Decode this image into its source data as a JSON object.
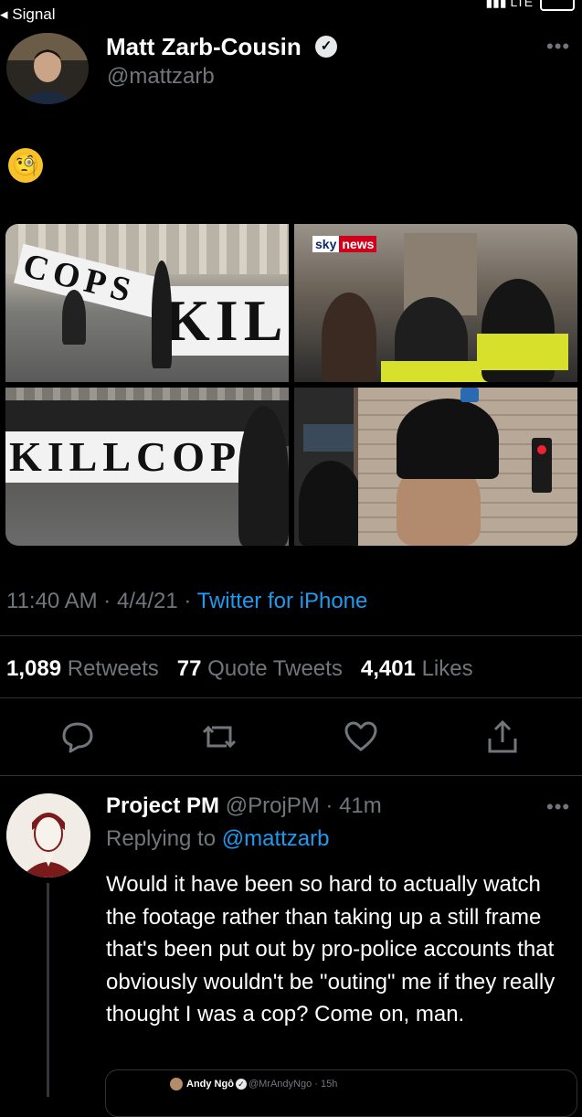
{
  "status_bar": {
    "back_label": "◂ Signal",
    "network": "LTE"
  },
  "tweet": {
    "author_name": "Matt Zarb-Cousin",
    "author_handle": "@mattzarb",
    "emoji": "🧐",
    "media": {
      "photo1_banner_top": "COPS",
      "photo1_banner_bottom": "KIL",
      "photo2_logo_sky": "sky",
      "photo2_logo_news": "news",
      "photo3_banner": "KILLCOPS"
    },
    "time": "11:40 AM",
    "date": "4/4/21",
    "source": "Twitter for iPhone",
    "retweets_count": "1,089",
    "retweets_label": "Retweets",
    "quotes_count": "77",
    "quotes_label": "Quote Tweets",
    "likes_count": "4,401",
    "likes_label": "Likes"
  },
  "reply": {
    "author_name": "Project PM",
    "author_handle": "@ProjPM",
    "age": "41m",
    "replying_label": "Replying to",
    "replying_to": "@mattzarb",
    "body": "Would it have been so hard to actually watch the footage rather than taking up a still frame that's been put out by pro-police accounts that obviously wouldn't be \"outing\" me if they really thought I was a cop? Come on, man.",
    "quoted": {
      "author_name": "Andy Ngô",
      "author_handle": "@MrAndyNgo",
      "age": "15h"
    }
  },
  "colors": {
    "accent": "#1d9bf0",
    "muted": "#71767b",
    "divider": "#2f3336"
  }
}
